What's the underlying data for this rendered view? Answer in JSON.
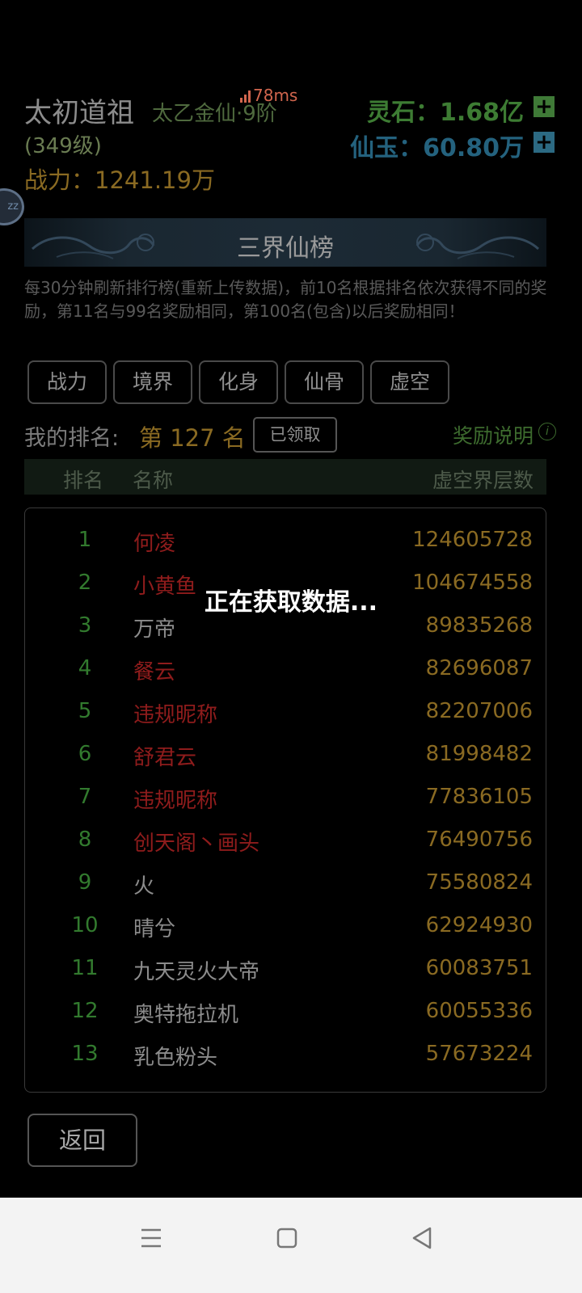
{
  "header": {
    "player_name": "太初道祖",
    "realm": "太乙金仙·9阶",
    "ping": "78ms",
    "level": "(349级)",
    "power_label": "战力：",
    "power_value": "1241.19万",
    "lingshi_label": "灵石：",
    "lingshi_value": "1.68亿",
    "xianyu_label": "仙玉：",
    "xianyu_value": "60.80万",
    "plus_symbol": "+",
    "avatar_text": "zz"
  },
  "banner": {
    "title": "三界仙榜"
  },
  "description": "每30分钟刷新排行榜(重新上传数据)，前10名根据排名依次获得不同的奖励，第11名与99名奖励相同，第100名(包含)以后奖励相同！",
  "tabs": [
    "战力",
    "境界",
    "化身",
    "仙骨",
    "虚空"
  ],
  "my_rank": {
    "label": "我的排名:",
    "value": "第 127 名",
    "claimed_button": "已领取",
    "reward_info": "奖励说明",
    "info_symbol": "i"
  },
  "table": {
    "headers": {
      "rank": "排名",
      "name": "名称",
      "value": "虚空界层数"
    },
    "rows": [
      {
        "rank": "1",
        "name": "何凌",
        "value": "124605728",
        "color": "red"
      },
      {
        "rank": "2",
        "name": "小黄鱼",
        "value": "104674558",
        "color": "red"
      },
      {
        "rank": "3",
        "name": "万帝",
        "value": "89835268",
        "color": "grey"
      },
      {
        "rank": "4",
        "name": "餐云",
        "value": "82696087",
        "color": "red"
      },
      {
        "rank": "5",
        "name": "违规昵称",
        "value": "82207006",
        "color": "red"
      },
      {
        "rank": "6",
        "name": "舒君云",
        "value": "81998482",
        "color": "red"
      },
      {
        "rank": "7",
        "name": "违规昵称",
        "value": "77836105",
        "color": "red"
      },
      {
        "rank": "8",
        "name": "创天阁丶画头",
        "value": "76490756",
        "color": "red"
      },
      {
        "rank": "9",
        "name": "火",
        "value": "75580824",
        "color": "grey"
      },
      {
        "rank": "10",
        "name": "晴兮",
        "value": "62924930",
        "color": "grey"
      },
      {
        "rank": "11",
        "name": "九天灵火大帝",
        "value": "60083751",
        "color": "grey"
      },
      {
        "rank": "12",
        "name": "奥特拖拉机",
        "value": "60055336",
        "color": "grey"
      },
      {
        "rank": "13",
        "name": "乳色粉头",
        "value": "57673224",
        "color": "grey"
      }
    ]
  },
  "loading_text": "正在获取数据...",
  "back_button": "返回",
  "colors": {
    "background": "#000000",
    "gold": "#8a6a22",
    "green": "#327a2e",
    "red_name": "#8f1c1c",
    "navbar": "#f3f3f3"
  },
  "icons": [
    "signal-bars-icon",
    "plus-icon",
    "info-icon",
    "menu-icon",
    "home-square-icon",
    "back-triangle-icon"
  ]
}
